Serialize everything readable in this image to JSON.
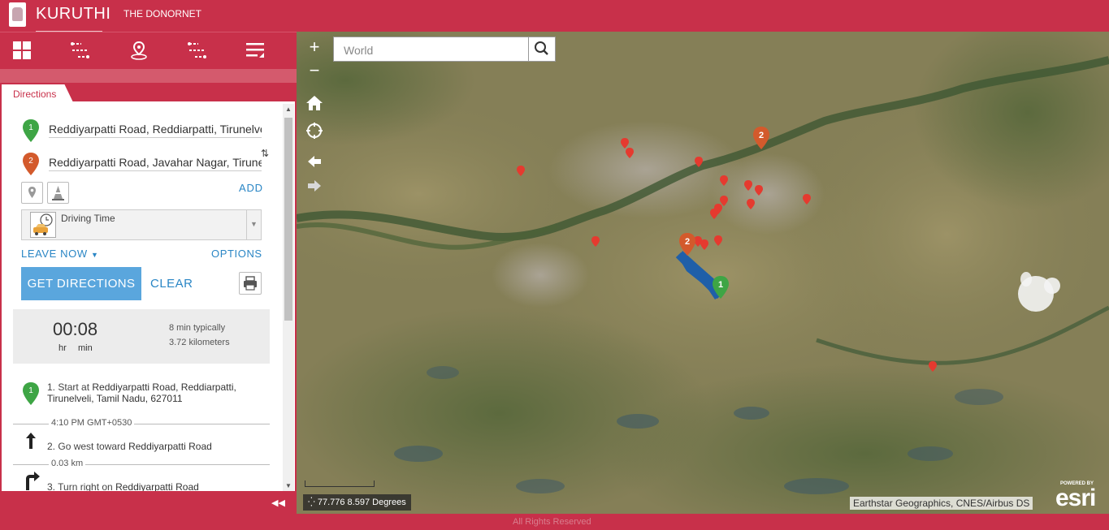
{
  "header": {
    "app_title": "KURUTHI",
    "app_subtitle": "THE DONORNET"
  },
  "toolbar": {
    "items": [
      {
        "name": "dashboard-icon"
      },
      {
        "name": "directions-icon"
      },
      {
        "name": "location-pin-icon"
      },
      {
        "name": "route-icon"
      },
      {
        "name": "menu-list-icon"
      }
    ]
  },
  "panel": {
    "tab_label": "Directions",
    "stops": [
      {
        "badge": "1",
        "value": "Reddiyarpatti Road, Reddiarpatti, Tirunelveli",
        "color": "#3ea545"
      },
      {
        "badge": "2",
        "value": "Reddiyarpatti Road, Javahar Nagar, Tirunelveli",
        "color": "#d35a2c"
      }
    ],
    "swap_icon": "swap-icon",
    "add_label": "ADD",
    "travel_mode": "Driving Time",
    "leave_label": "LEAVE NOW",
    "options_label": "OPTIONS",
    "get_directions_label": "GET DIRECTIONS",
    "clear_label": "CLEAR",
    "summary": {
      "time": "00:08",
      "hr_label": "hr",
      "min_label": "min",
      "typical": "8 min typically",
      "distance": "3.72 kilometers"
    },
    "steps": [
      {
        "index": "1.",
        "text": "Start at ",
        "strong": "Reddiyarpatti Road, Reddiarpatti, Tirunelveli, Tamil Nadu, 627011"
      },
      {
        "divider": "4:10 PM GMT+0530"
      },
      {
        "index": "2.",
        "text": "Go west toward ",
        "strong": "Reddiyarpatti Road"
      },
      {
        "divider": "0.03 km"
      },
      {
        "index": "3.",
        "text": "Turn right on ",
        "strong": "Reddiyarpatti Road"
      }
    ]
  },
  "map": {
    "search_placeholder": "World",
    "zoom_in": "+",
    "zoom_out": "−",
    "coordinates": "77.776 8.597 Degrees",
    "attribution": "Earthstar Geographics, CNES/Airbus DS",
    "powered_by": "POWERED BY",
    "esri_logo": "esri",
    "route_color": "#1f5fa8",
    "marker_color": "#e53a2f"
  },
  "footer": {
    "text": "All Rights Reserved"
  }
}
